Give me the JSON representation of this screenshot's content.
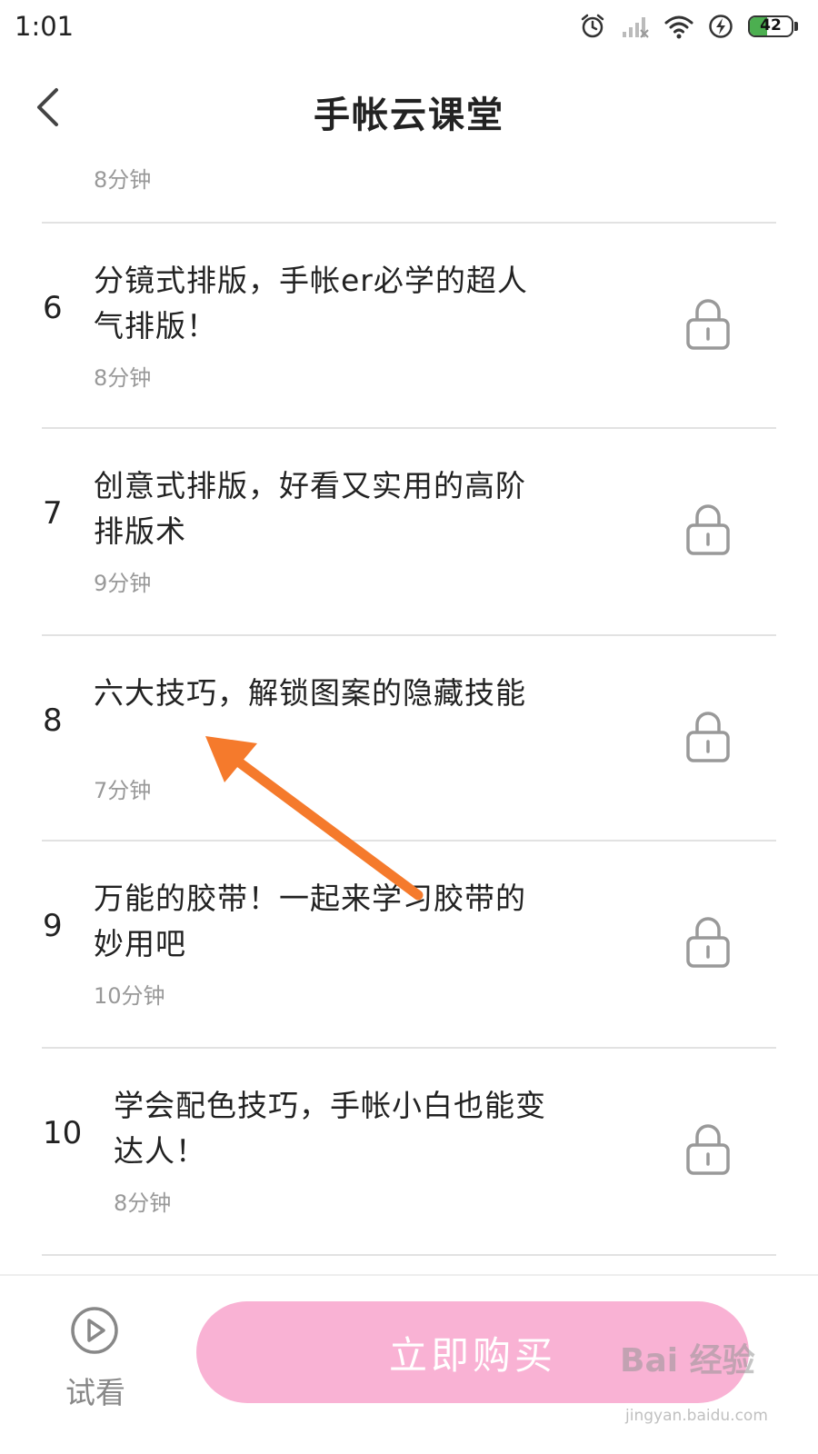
{
  "status_bar": {
    "time": "1:01",
    "battery_level": "42"
  },
  "nav": {
    "title": "手帐云课堂"
  },
  "list": {
    "partial_duration": "8分钟",
    "lessons": [
      {
        "number": "6",
        "title": "分镜式排版，手帐er必学的超人气排版！",
        "duration": "8分钟"
      },
      {
        "number": "7",
        "title": "创意式排版，好看又实用的高阶排版术",
        "duration": "9分钟"
      },
      {
        "number": "8",
        "title": "六大技巧，解锁图案的隐藏技能",
        "duration": "7分钟"
      },
      {
        "number": "9",
        "title": "万能的胶带！一起来学习胶带的妙用吧",
        "duration": "10分钟"
      },
      {
        "number": "10",
        "title": "学会配色技巧，手帐小白也能变达人！",
        "duration": "8分钟"
      }
    ]
  },
  "bottom_bar": {
    "trial_label": "试看",
    "buy_label": "立即购买"
  },
  "watermark": {
    "logo_text": "Bai 经验",
    "url": "jingyan.baidu.com"
  },
  "colors": {
    "buy_button": "#f9b2d4",
    "arrow": "#f57a2c",
    "battery": "#4caf50"
  }
}
